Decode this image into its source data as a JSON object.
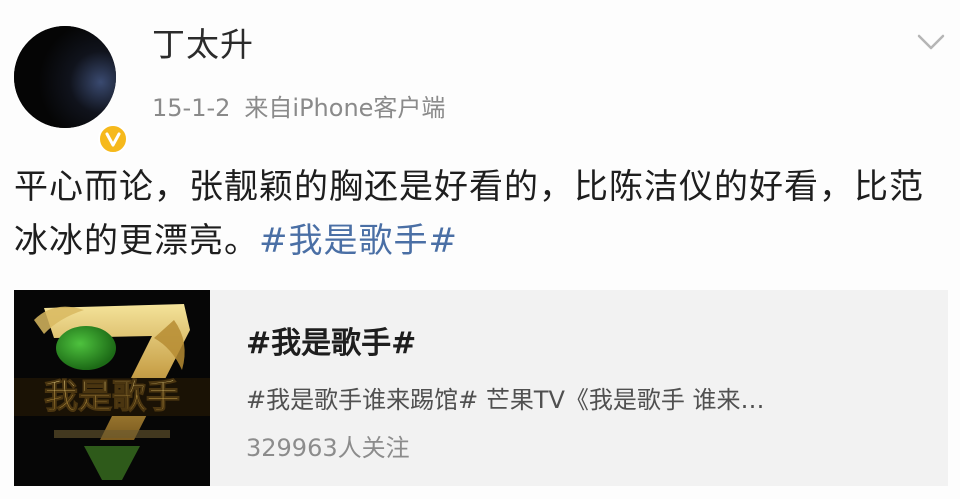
{
  "post": {
    "username": "丁太升",
    "date": "15-1-2",
    "source": "来自iPhone客户端",
    "text_main": "平心而论，张靓颖的胸还是好看的，比陈洁仪的好看，比范冰冰的更漂亮。",
    "text_hashtag": "#我是歌手#"
  },
  "card": {
    "title": "#我是歌手#",
    "description": "#我是歌手谁来踢馆# 芒果TV《我是歌手 谁来…",
    "followers": "329963人关注",
    "thumb_logo_text": "我是歌手"
  },
  "icons": {
    "avatar": "avatar",
    "badge": "verified-badge-icon",
    "more": "chevron-down-icon"
  },
  "colors": {
    "hashtag": "#4a6fa5",
    "badge": "#f6b91c",
    "card_bg": "#f2f2f2"
  }
}
